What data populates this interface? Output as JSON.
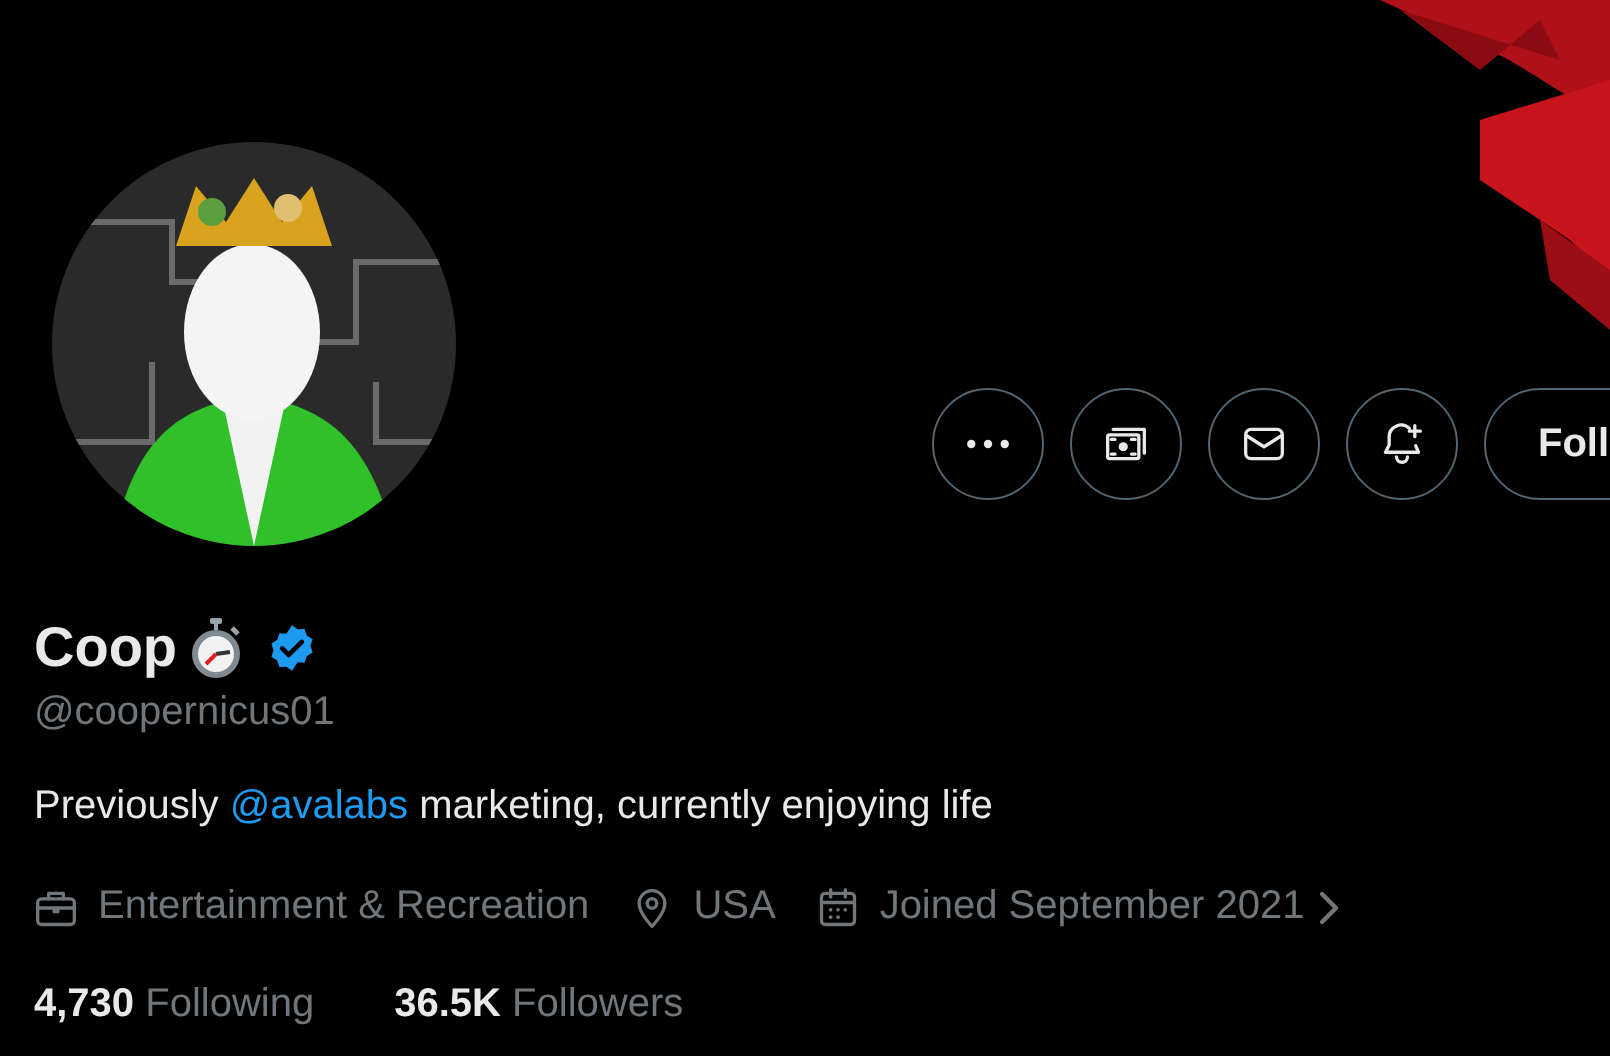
{
  "actions": [
    {
      "kind": "more"
    },
    {
      "kind": "tip"
    },
    {
      "kind": "message"
    },
    {
      "kind": "notify"
    },
    {
      "kind": "follow",
      "label": "Foll"
    }
  ],
  "profile": {
    "name": "Coop",
    "stopwatch_emoji": true,
    "verified": true,
    "handle": "@coopernicus01",
    "bio": [
      {
        "kind": "text",
        "text": "Previously "
      },
      {
        "kind": "mention",
        "text": "@avalabs"
      },
      {
        "kind": "text",
        "text": " marketing, currently enjoying life"
      }
    ],
    "meta": [
      {
        "kind": "category",
        "text": "Entertainment & Recreation"
      },
      {
        "kind": "location",
        "text": "USA"
      },
      {
        "kind": "joined",
        "text": "Joined September 2021"
      }
    ],
    "stats": [
      {
        "value": "4,730",
        "label": "Following"
      },
      {
        "value": "36.5K",
        "label": "Followers"
      }
    ]
  }
}
